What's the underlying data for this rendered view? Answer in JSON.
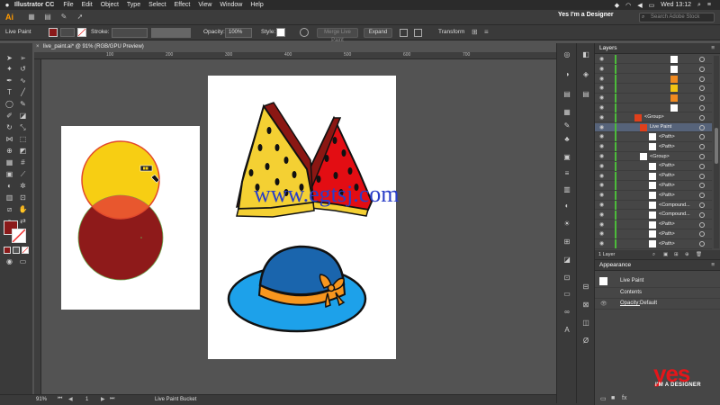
{
  "menubar": {
    "app_name": "Illustrator CC",
    "menus": [
      "File",
      "Edit",
      "Object",
      "Type",
      "Select",
      "Effect",
      "View",
      "Window",
      "Help"
    ],
    "clock": "Wed 13:12"
  },
  "appbar": {
    "app_abbr": "Ai",
    "workspace": "Yes I'm a Designer",
    "search_placeholder": "Search Adobe Stock"
  },
  "controlbar": {
    "selection_label": "Live Paint",
    "stroke_label": "Stroke:",
    "opacity_label": "Opacity:",
    "opacity_value": "100%",
    "style_label": "Style:",
    "merge_button": "Merge Live Paint",
    "expand_button": "Expand",
    "transform_button": "Transform",
    "fill_color": "#8b1a1a"
  },
  "document": {
    "tab_title": "live_paint.ai* @ 91% (RGB/GPU Preview)",
    "ruler_ticks": [
      "100",
      "200",
      "300",
      "400",
      "500",
      "600",
      "700"
    ]
  },
  "statusbar": {
    "zoom": "91%",
    "page": "1",
    "tool_name": "Live Paint Bucket"
  },
  "layers_panel": {
    "tab_label": "Layers",
    "rows": [
      {
        "name": "",
        "thumb": "#ffffff"
      },
      {
        "name": "",
        "thumb": "#ffffff"
      },
      {
        "name": "",
        "thumb": "#f08a20"
      },
      {
        "name": "",
        "thumb": "#f3c413"
      },
      {
        "name": "",
        "thumb": "#f08a20"
      },
      {
        "name": "",
        "thumb": "#ffffff"
      },
      {
        "name": "<Group>",
        "thumb": "#e0401c"
      },
      {
        "name": "Live Paint",
        "thumb": "#e0401c"
      },
      {
        "name": "<Path>",
        "thumb": "#ffffff"
      },
      {
        "name": "<Path>",
        "thumb": "#ffffff"
      },
      {
        "name": "<Group>",
        "thumb": "#ffffff"
      },
      {
        "name": "<Path>",
        "thumb": "#ffffff"
      },
      {
        "name": "<Path>",
        "thumb": "#ffffff"
      },
      {
        "name": "<Path>",
        "thumb": "#ffffff"
      },
      {
        "name": "<Path>",
        "thumb": "#ffffff"
      },
      {
        "name": "<Compound...",
        "thumb": "#ffffff"
      },
      {
        "name": "<Compound...",
        "thumb": "#ffffff"
      },
      {
        "name": "<Path>",
        "thumb": "#ffffff"
      },
      {
        "name": "<Path>",
        "thumb": "#ffffff"
      },
      {
        "name": "<Path>",
        "thumb": "#ffffff"
      }
    ],
    "footer": "1 Layer"
  },
  "appearance_panel": {
    "tab_label": "Appearance",
    "title": "Live Paint",
    "contents": "Contents",
    "opacity_label": "Opacity:",
    "opacity_value": "Default"
  },
  "watermark": "www.egtsj.com",
  "brand": {
    "big": "yes",
    "small": "I'M A DESIGNER"
  },
  "colors": {
    "circle_top": "#f7ce13",
    "circle_bottom": "#8e1a1a",
    "intersection": "#e8572e",
    "watermelon_yellow": "#f4d033",
    "watermelon_red": "#e30d13",
    "hat_blue": "#1da1ea",
    "hat_dark_blue": "#1a65ad",
    "ribbon_orange": "#f7961e",
    "accent_red": "#e5161a"
  }
}
